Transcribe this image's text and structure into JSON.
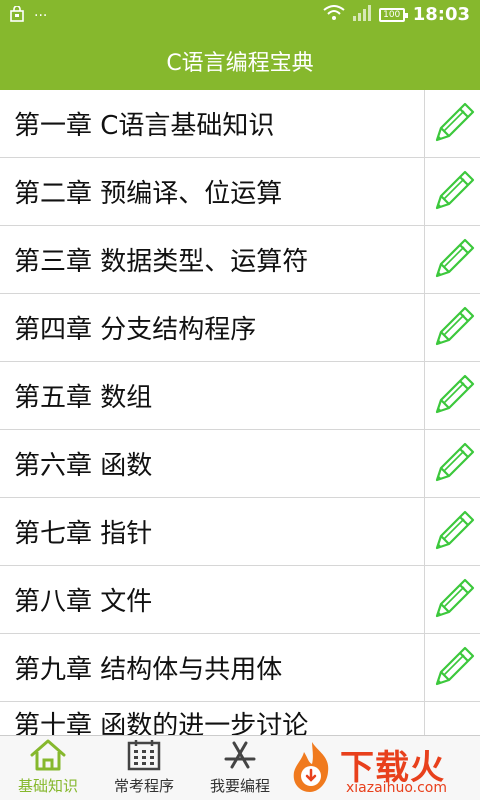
{
  "status_bar": {
    "time": "18:03",
    "battery": "100",
    "icons": [
      "notification-icon",
      "more-icon",
      "wifi-icon",
      "signal-icon",
      "battery-icon"
    ]
  },
  "app_bar": {
    "title": "C语言编程宝典"
  },
  "chapters": [
    {
      "label": "第一章 C语言基础知识"
    },
    {
      "label": "第二章 预编译、位运算"
    },
    {
      "label": "第三章 数据类型、运算符"
    },
    {
      "label": "第四章 分支结构程序"
    },
    {
      "label": "第五章 数组"
    },
    {
      "label": "第六章 函数"
    },
    {
      "label": "第七章 指针"
    },
    {
      "label": "第八章 文件"
    },
    {
      "label": "第九章 结构体与共用体"
    },
    {
      "label": "第十章 函数的进一步讨论"
    }
  ],
  "bottom_nav": {
    "tabs": [
      {
        "label": "基础知识",
        "icon": "home-icon",
        "active": true
      },
      {
        "label": "常考程序",
        "icon": "calendar-icon",
        "active": false
      },
      {
        "label": "我要编程",
        "icon": "app-store-icon",
        "active": false
      }
    ]
  },
  "watermark": {
    "text": "下载火",
    "url": "xiazaihuo.com"
  },
  "colors": {
    "accent": "#86b82d",
    "pencil": "#3cc83c",
    "divider": "#d6d6d6",
    "watermark": "#e8401c"
  }
}
